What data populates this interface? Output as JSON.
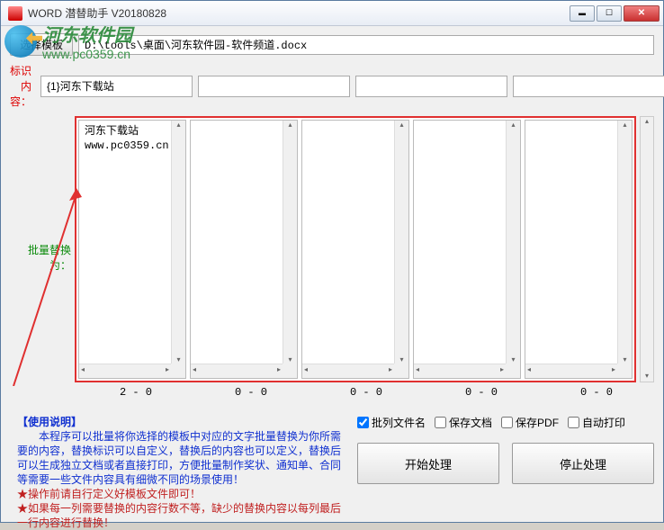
{
  "window": {
    "title": "WORD 潜替助手 V20180828"
  },
  "template": {
    "button_label": "选择模板",
    "path": "D:\\tools\\桌面\\河东软件园-软件频道.docx"
  },
  "marker": {
    "label": "标识内容：",
    "inputs": [
      "{1}河东下载站",
      "",
      "",
      "",
      ""
    ]
  },
  "replace": {
    "label": "批量替换为：",
    "columns": [
      {
        "content": "河东下载站\nwww.pc0359.cn",
        "count": "2 - 0"
      },
      {
        "content": "",
        "count": "0 - 0"
      },
      {
        "content": "",
        "count": "0 - 0"
      },
      {
        "content": "",
        "count": "0 - 0"
      },
      {
        "content": "",
        "count": "0 - 0"
      }
    ]
  },
  "instructions": {
    "header": "【使用说明】",
    "body": "　　本程序可以批量将你选择的模板中对应的文字批量替换为你所需要的内容，替换标识可以自定义，替换后的内容也可以定义，替换后可以生成独立文档或者直接打印，方便批量制作奖状、通知单、合同等需要一些文件内容具有细微不同的场景使用！",
    "star1": "★操作前请自行定义好模板文件即可！",
    "star2": "★如果每一列需要替换的内容行数不等，缺少的替换内容以每列最后一行内容进行替换！"
  },
  "options": {
    "batch_filename": {
      "label": "批列文件名",
      "checked": true
    },
    "save_doc": {
      "label": "保存文档",
      "checked": false
    },
    "save_pdf": {
      "label": "保存PDF",
      "checked": false
    },
    "auto_print": {
      "label": "自动打印",
      "checked": false
    }
  },
  "actions": {
    "start": "开始处理",
    "stop": "停止处理"
  },
  "watermark": {
    "cn_text": "河东软件园",
    "url_text": "www.pc0359.cn"
  }
}
